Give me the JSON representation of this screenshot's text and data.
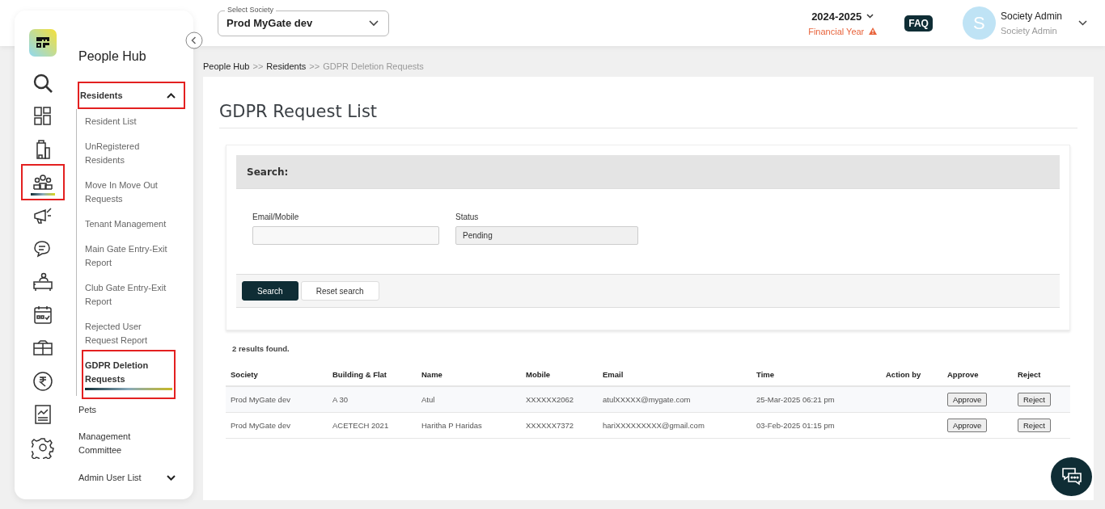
{
  "header": {
    "society_select": {
      "label": "Select Society",
      "value": "Prod MyGate dev"
    },
    "year": {
      "value": "2024-2025",
      "caption": "Financial Year"
    },
    "faq": "FAQ",
    "user": {
      "initial": "S",
      "name": "Society Admin",
      "role": "Society Admin"
    }
  },
  "rail": [
    {
      "kind": "search",
      "selected": false,
      "highlighted": false
    },
    {
      "kind": "dashboard",
      "selected": false,
      "highlighted": false
    },
    {
      "kind": "building",
      "selected": false,
      "highlighted": false
    },
    {
      "kind": "people",
      "selected": true,
      "highlighted": true
    },
    {
      "kind": "megaphone",
      "selected": false,
      "highlighted": false
    },
    {
      "kind": "chat",
      "selected": false,
      "highlighted": false
    },
    {
      "kind": "desk",
      "selected": false,
      "highlighted": false
    },
    {
      "kind": "calendar",
      "selected": false,
      "highlighted": false
    },
    {
      "kind": "parcel",
      "selected": false,
      "highlighted": false
    },
    {
      "kind": "rupee",
      "selected": false,
      "highlighted": false
    },
    {
      "kind": "report",
      "selected": false,
      "highlighted": false
    },
    {
      "kind": "settings",
      "selected": false,
      "highlighted": false
    }
  ],
  "sidebar": {
    "title": "People Hub",
    "sections": [
      {
        "label": "Residents",
        "kind": "group",
        "expanded": true,
        "highlighted": true,
        "children": [
          {
            "label": "Resident List",
            "selected": false,
            "highlighted": false
          },
          {
            "label": "UnRegistered Residents",
            "selected": false,
            "highlighted": false
          },
          {
            "label": "Move In Move Out Requests",
            "selected": false,
            "highlighted": false
          },
          {
            "label": "Tenant Management",
            "selected": false,
            "highlighted": false
          },
          {
            "label": "Main Gate Entry-Exit Report",
            "selected": false,
            "highlighted": false
          },
          {
            "label": "Club Gate Entry-Exit Report",
            "selected": false,
            "highlighted": false
          },
          {
            "label": "Rejected User Request Report",
            "selected": false,
            "highlighted": false
          },
          {
            "label": "GDPR Deletion Requests",
            "selected": true,
            "highlighted": true
          }
        ]
      },
      {
        "label": "Pets",
        "kind": "link",
        "expanded": false,
        "highlighted": false
      },
      {
        "label": "Management Committee",
        "kind": "link",
        "expanded": false,
        "highlighted": false
      },
      {
        "label": "Admin User List",
        "kind": "group",
        "expanded": false,
        "highlighted": false
      }
    ]
  },
  "breadcrumb": [
    {
      "label": "People Hub",
      "current": false
    },
    {
      "label": "Residents",
      "current": false
    },
    {
      "label": "GDPR Deletion Requests",
      "current": true
    }
  ],
  "breadcrumb_separator": ">>",
  "page_title": "GDPR Request List",
  "search": {
    "title": "Search:",
    "fields": [
      {
        "label": "Email/Mobile",
        "kind": "input"
      },
      {
        "label": "Status",
        "value": "Pending",
        "kind": "select"
      }
    ],
    "buttons": [
      {
        "label": "Search",
        "primary": true
      },
      {
        "label": "Reset search",
        "primary": false
      }
    ]
  },
  "results_count": "2 results found.",
  "table": {
    "columns": [
      "Society",
      "Building & Flat",
      "Name",
      "Mobile",
      "Email",
      "Time",
      "Action by",
      "Approve",
      "Reject"
    ],
    "rows": [
      {
        "cells": [
          "Prod MyGate dev",
          "A 30",
          "Atul",
          "XXXXXX2062",
          "atulXXXXX@mygate.com",
          "25-Mar-2025 06:21 pm"
        ],
        "approve": "Approve",
        "reject": "Reject"
      },
      {
        "cells": [
          "Prod MyGate dev",
          "ACETECH 2021",
          "Haritha P Haridas",
          "XXXXXX7372",
          "hariXXXXXXXXX@gmail.com",
          "03-Feb-2025 01:15 pm"
        ],
        "approve": "Approve",
        "reject": "Reject"
      }
    ]
  }
}
